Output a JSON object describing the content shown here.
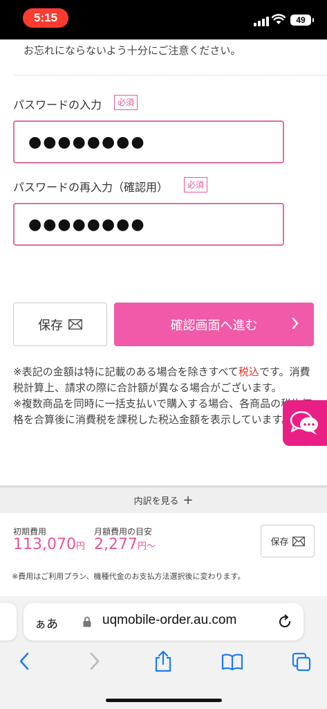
{
  "status_bar": {
    "time": "5:15",
    "battery": "49"
  },
  "form": {
    "top_notice": "お忘れにならないよう十分にご注意ください。",
    "password": {
      "label": "パスワードの入力",
      "badge": "必須",
      "masked_value": "●●●●●●●●"
    },
    "password_confirm": {
      "label": "パスワードの再入力（確認用）",
      "badge": "必須",
      "masked_value": "●●●●●●●●"
    }
  },
  "actions": {
    "save_label": "保存",
    "confirm_label": "確認画面へ進む"
  },
  "notes": {
    "line1_pre": "※表記の金額は特に記載のある場合を除きすべて",
    "line1_red": "税込",
    "line1_post": "です。消費税計算上、請求の際に合計額が異なる場合がございます。",
    "line2": "※複数商品を同時に一括支払いで購入する場合、各商品の税抜価格を合算後に消費税を課税した税込金額を表示しています。"
  },
  "summary": {
    "breakdown_label": "内訳を見る",
    "initial_cost": {
      "label": "初期費用",
      "value": "113,070",
      "unit": "円"
    },
    "monthly_cost": {
      "label": "月額費用の目安",
      "value": "2,277",
      "unit": "円〜"
    },
    "save_label": "保存",
    "fee_note": "※費用はご利用プラン、機種代金のお支払方法選択後に変わります。"
  },
  "browser": {
    "aa_label": "ぁあ",
    "url": "uqmobile-order.au.com"
  },
  "colors": {
    "accent": "#f05aa8",
    "badge": "#e8559e",
    "chat": "#ea1f86",
    "status_pill": "#ff3b30",
    "ios_blue": "#1a7cf5"
  }
}
